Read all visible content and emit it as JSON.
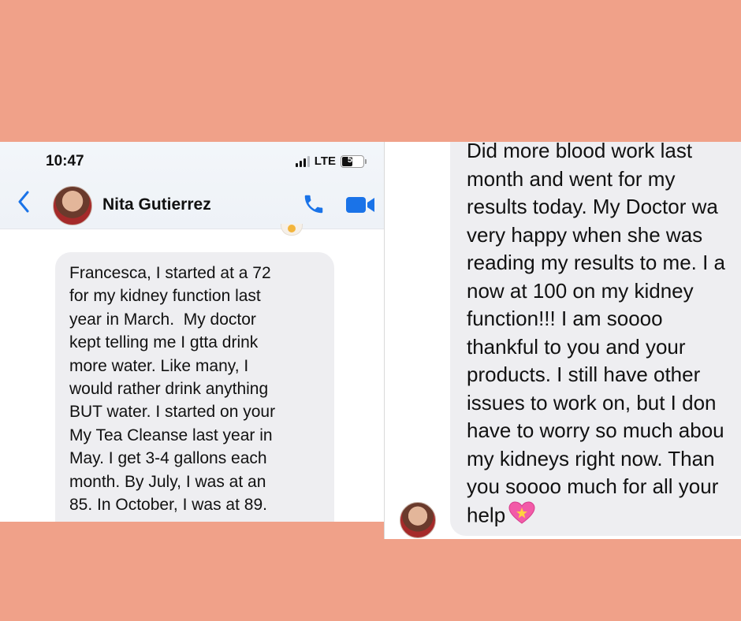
{
  "left_screen": {
    "status": {
      "time": "10:47",
      "network": "LTE",
      "battery": "55",
      "battery_level_percent": 55
    },
    "header": {
      "contact_name": "Nita Gutierrez",
      "icons": [
        "back-chevron-icon",
        "avatar",
        "phone-icon",
        "video-camera-icon"
      ]
    },
    "message_lines": [
      "Francesca, I started at a 72",
      "for my kidney function last",
      "year in March.  My doctor",
      "kept telling me I gtta drink",
      "more water. Like many, I",
      "would rather drink anything",
      "BUT water. I started on your",
      "My Tea Cleanse last year in",
      "May. I get 3-4 gallons each",
      "month. By July, I was at an",
      "85. In October, I was at 89."
    ]
  },
  "right_screen": {
    "message_lines": [
      "Did more blood work last",
      "month and went for my",
      "results today. My Doctor wa",
      "very happy when she was",
      "reading my results to me. I a",
      "now at 100 on my kidney",
      "function!!! I am soooo",
      "thankful to you and your",
      "products. I still have other",
      "issues to work on, but I don",
      "have to worry so much abou",
      "my kidneys right now. Than",
      "you soooo much for all your",
      "help"
    ],
    "emoji": "sparkling-heart-icon"
  },
  "colors": {
    "background": "#f0a189",
    "bubble": "#eeeef1",
    "accent_blue": "#1a73e8"
  }
}
